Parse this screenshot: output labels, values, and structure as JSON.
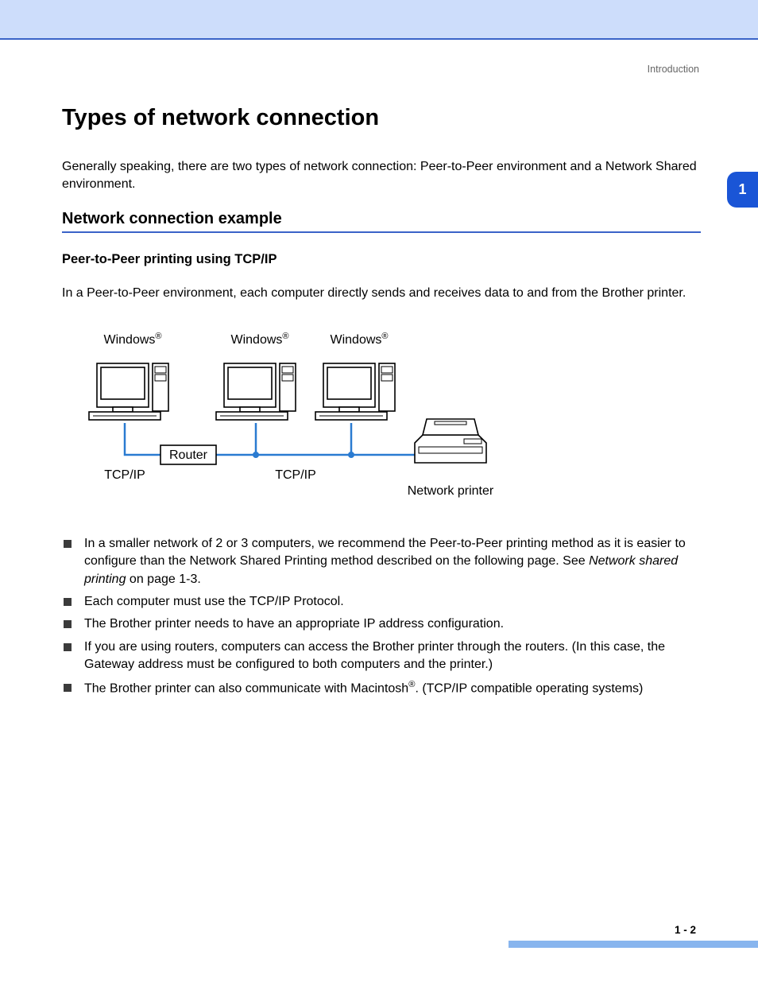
{
  "header": {
    "breadcrumb": "Introduction"
  },
  "chapter_tab": "1",
  "title": "Types of network connection",
  "intro": "Generally speaking, there are two types of network connection: Peer-to-Peer environment and a Network Shared environment.",
  "subtitle": "Network connection example",
  "subsub": "Peer-to-Peer printing using TCP/IP",
  "p2p_intro": "In a Peer-to-Peer environment, each computer directly sends and receives data to and from the Brother printer.",
  "diagram": {
    "pc_label": "Windows",
    "pc_label_reg": "®",
    "router": "Router",
    "tcpip": "TCP/IP",
    "printer": "Network printer"
  },
  "bullets": {
    "b1a": "In a smaller network of 2 or 3 computers, we recommend the Peer-to-Peer printing method as it is easier to configure than the Network Shared Printing method described on the following page. See ",
    "b1_link": "Network shared printing",
    "b1b": " on page 1-3.",
    "b2": "Each computer must use the TCP/IP Protocol.",
    "b3": "The Brother printer needs to have an appropriate IP address configuration.",
    "b4": "If you are using routers, computers can access the Brother printer through the routers. (In this case, the Gateway address must be configured to both computers and the printer.)",
    "b5a": "The Brother printer can also communicate with Macintosh",
    "b5_reg": "®",
    "b5b": ". (TCP/IP compatible operating systems)"
  },
  "footer": {
    "page_num": "1 - 2"
  }
}
